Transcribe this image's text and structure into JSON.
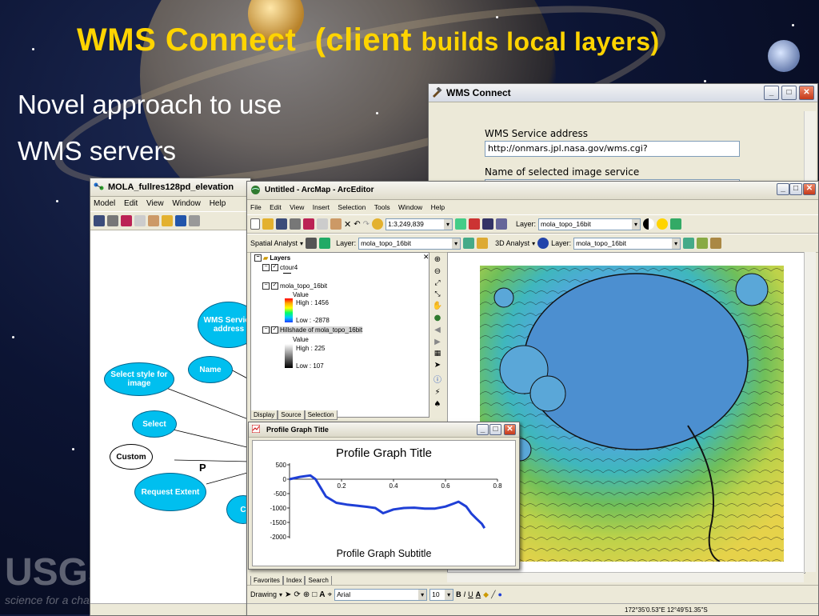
{
  "slide": {
    "title_main": "WMS Connect",
    "title_paren_open": "(client",
    "title_paren_rest": "builds local layers)",
    "bullet1": "Novel approach to use",
    "bullet2": "WMS servers",
    "logo_text": "USGS",
    "logo_tagline": "science for a changing world"
  },
  "wms_window": {
    "title": "WMS Connect",
    "service_label": "WMS Service address",
    "service_value": "http://onmars.jpl.nasa.gov/wms.cgi?",
    "name_label": "Name of selected image service"
  },
  "model_window": {
    "title": "MOLA_fullres128pd_elevation",
    "menu": [
      "Model",
      "Edit",
      "View",
      "Window",
      "Help"
    ],
    "nodes": {
      "wms": "WMS Service address",
      "name": "Name",
      "style": "Select style for image",
      "select": "Select",
      "custom": "Custom",
      "extent": "Request Extent",
      "partial": "C",
      "p_label": "P"
    }
  },
  "arcmap": {
    "title": "Untitled - ArcMap - ArcEditor",
    "menu": [
      "File",
      "Edit",
      "View",
      "Insert",
      "Selection",
      "Tools",
      "Window",
      "Help"
    ],
    "scale": "1:3,249,839",
    "layer_label": "Layer:",
    "layer_value": "mola_topo_16bit",
    "spatial_analyst": "Spatial Analyst",
    "analyst3d": "3D Analyst",
    "toc": {
      "root": "Layers",
      "items": [
        {
          "name": "ctour4"
        },
        {
          "name": "mola_topo_16bit",
          "value": "Value",
          "high": "High : 1456",
          "low": "Low : -2878"
        },
        {
          "name": "Hillshade of mola_topo_16bit",
          "value": "Value",
          "high": "High : 225",
          "low": "Low : 107"
        }
      ],
      "tabs": [
        "Display",
        "Source",
        "Selection"
      ],
      "tabs_bottom": [
        "Favorites",
        "Index",
        "Search"
      ]
    },
    "drawing": "Drawing",
    "font": "Arial",
    "font_size": "10",
    "status_coords": "172°35'0.53\"E  12°49'51.35\"S"
  },
  "profile": {
    "window_title": "Profile Graph Title",
    "chart_data": {
      "type": "line",
      "title": "Profile Graph Title",
      "subtitle": "Profile Graph Subtitle",
      "x_ticks": [
        "0.2",
        "0.4",
        "0.6",
        "0.8"
      ],
      "y_ticks": [
        "500",
        "0",
        "-500",
        "-1000",
        "-1500",
        "-2000"
      ],
      "xlim": [
        0,
        0.8
      ],
      "ylim": [
        -2000,
        500
      ],
      "series": [
        {
          "x": [
            0.0,
            0.04,
            0.08,
            0.1,
            0.12,
            0.14,
            0.18,
            0.22,
            0.26,
            0.3,
            0.33,
            0.36,
            0.4,
            0.44,
            0.48,
            0.52,
            0.56,
            0.6,
            0.63,
            0.65,
            0.68,
            0.7,
            0.72,
            0.74,
            0.75
          ],
          "y": [
            0,
            80,
            130,
            0,
            -300,
            -600,
            -820,
            -880,
            -920,
            -960,
            -1000,
            -1180,
            -1050,
            -1000,
            -990,
            -1020,
            -1020,
            -950,
            -850,
            -780,
            -950,
            -1200,
            -1380,
            -1550,
            -1700
          ],
          "color": "#1f3fd6"
        }
      ]
    }
  }
}
